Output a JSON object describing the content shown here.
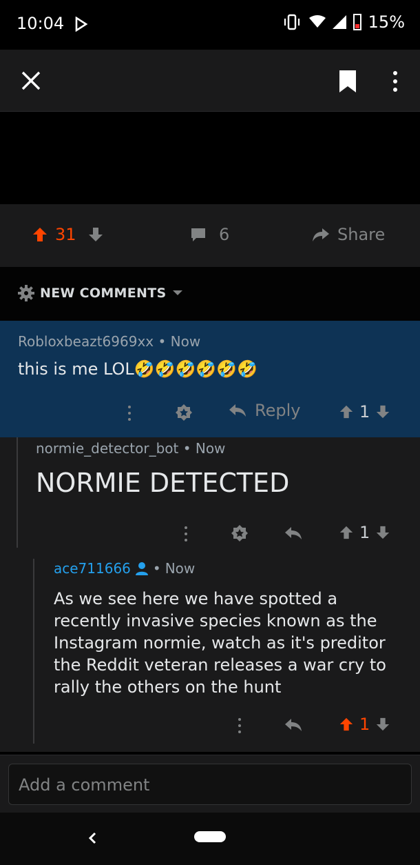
{
  "status_bar": {
    "time": "10:04",
    "battery": "15%"
  },
  "post": {
    "score": "31",
    "comments_count": "6",
    "share_label": "Share"
  },
  "sort": {
    "label": "NEW COMMENTS"
  },
  "comments": [
    {
      "author": "Robloxbeazt6969xx",
      "time": "Now",
      "body": "this is me LOL🤣🤣🤣🤣🤣🤣",
      "reply_label": "Reply",
      "score": "1"
    },
    {
      "author": "normie_detector_bot",
      "time": "Now",
      "body": "NORMIE DETECTED",
      "score": "1"
    },
    {
      "author": "ace711666",
      "time": "Now",
      "body": "As we see here we have spotted a recently invasive species known as the Instagram normie, watch as it's preditor the Reddit veteran releases a war cry to rally the others on the hunt",
      "score": "1"
    }
  ],
  "composer": {
    "placeholder": "Add a comment"
  },
  "colors": {
    "upvote": "#ff4500",
    "highlight": "#0e3355",
    "username": "#24a0ed"
  },
  "icons": [
    "close-icon",
    "bookmark-icon",
    "more-vert-icon",
    "upvote-icon",
    "downvote-icon",
    "comment-icon",
    "share-icon",
    "gear-icon",
    "reply-icon",
    "award-icon",
    "user-icon",
    "back-icon"
  ]
}
